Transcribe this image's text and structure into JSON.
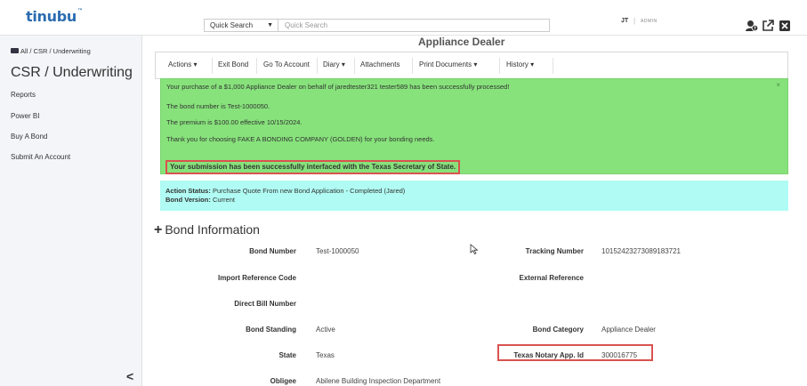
{
  "header": {
    "logo": "tinubu",
    "logo_tm": "™",
    "quick_search_select": "Quick Search",
    "quick_search_placeholder": "Quick Search",
    "user_initials": "JT",
    "user_separator": "|",
    "user_role": "ADMIN",
    "icons": [
      "help-user-icon",
      "external-link-icon",
      "close-icon"
    ]
  },
  "sidebar": {
    "breadcrumb": "All / CSR / Underwriting",
    "title": "CSR / Underwriting",
    "items": [
      {
        "label": "Reports"
      },
      {
        "label": "Power BI"
      },
      {
        "label": "Buy A Bond"
      },
      {
        "label": "Submit An Account"
      }
    ],
    "collapse_glyph": "<"
  },
  "main": {
    "title": "Appliance Dealer",
    "toolbar": [
      {
        "label": "Actions",
        "caret": true
      },
      {
        "label": "Exit Bond",
        "caret": false
      },
      {
        "label": "Go To Account",
        "caret": false
      },
      {
        "label": "Diary",
        "caret": true
      },
      {
        "label": "Attachments",
        "caret": false
      },
      {
        "label": "Print Documents",
        "caret": true
      },
      {
        "label": "History",
        "caret": true
      }
    ],
    "success": {
      "line1": "Your purchase of a $1,000 Appliance Dealer on behalf of jaredtester321 tester589 has been successfully processed!",
      "line2": "The bond number is Test-1000050.",
      "line3": "The premium is $100.00 effective 10/15/2024.",
      "line4": "Thank you for choosing FAKE A BONDING COMPANY (GOLDEN) for your bonding needs.",
      "highlight": "Your submission has been successfully interfaced with the Texas Secretary of State.",
      "close": "×"
    },
    "status": {
      "action_label": "Action Status:",
      "action_value": "Purchase Quote From new Bond Application - Completed (Jared)",
      "version_label": "Bond Version:",
      "version_value": "Current"
    },
    "bond_info": {
      "header": "Bond Information",
      "fields": {
        "bond_number": {
          "label": "Bond Number",
          "value": "Test-1000050"
        },
        "tracking_number": {
          "label": "Tracking Number",
          "value": "10152423273089183721"
        },
        "import_ref": {
          "label": "Import Reference Code",
          "value": ""
        },
        "external_ref": {
          "label": "External Reference",
          "value": ""
        },
        "direct_bill": {
          "label": "Direct Bill Number",
          "value": ""
        },
        "bond_standing": {
          "label": "Bond Standing",
          "value": "Active"
        },
        "bond_category": {
          "label": "Bond Category",
          "value": "Appliance Dealer"
        },
        "state": {
          "label": "State",
          "value": "Texas"
        },
        "notary": {
          "label": "Texas Notary App. Id",
          "value": "300016775"
        },
        "obligee": {
          "label": "Obligee",
          "value": "Abilene Building Inspection Department"
        }
      }
    }
  }
}
